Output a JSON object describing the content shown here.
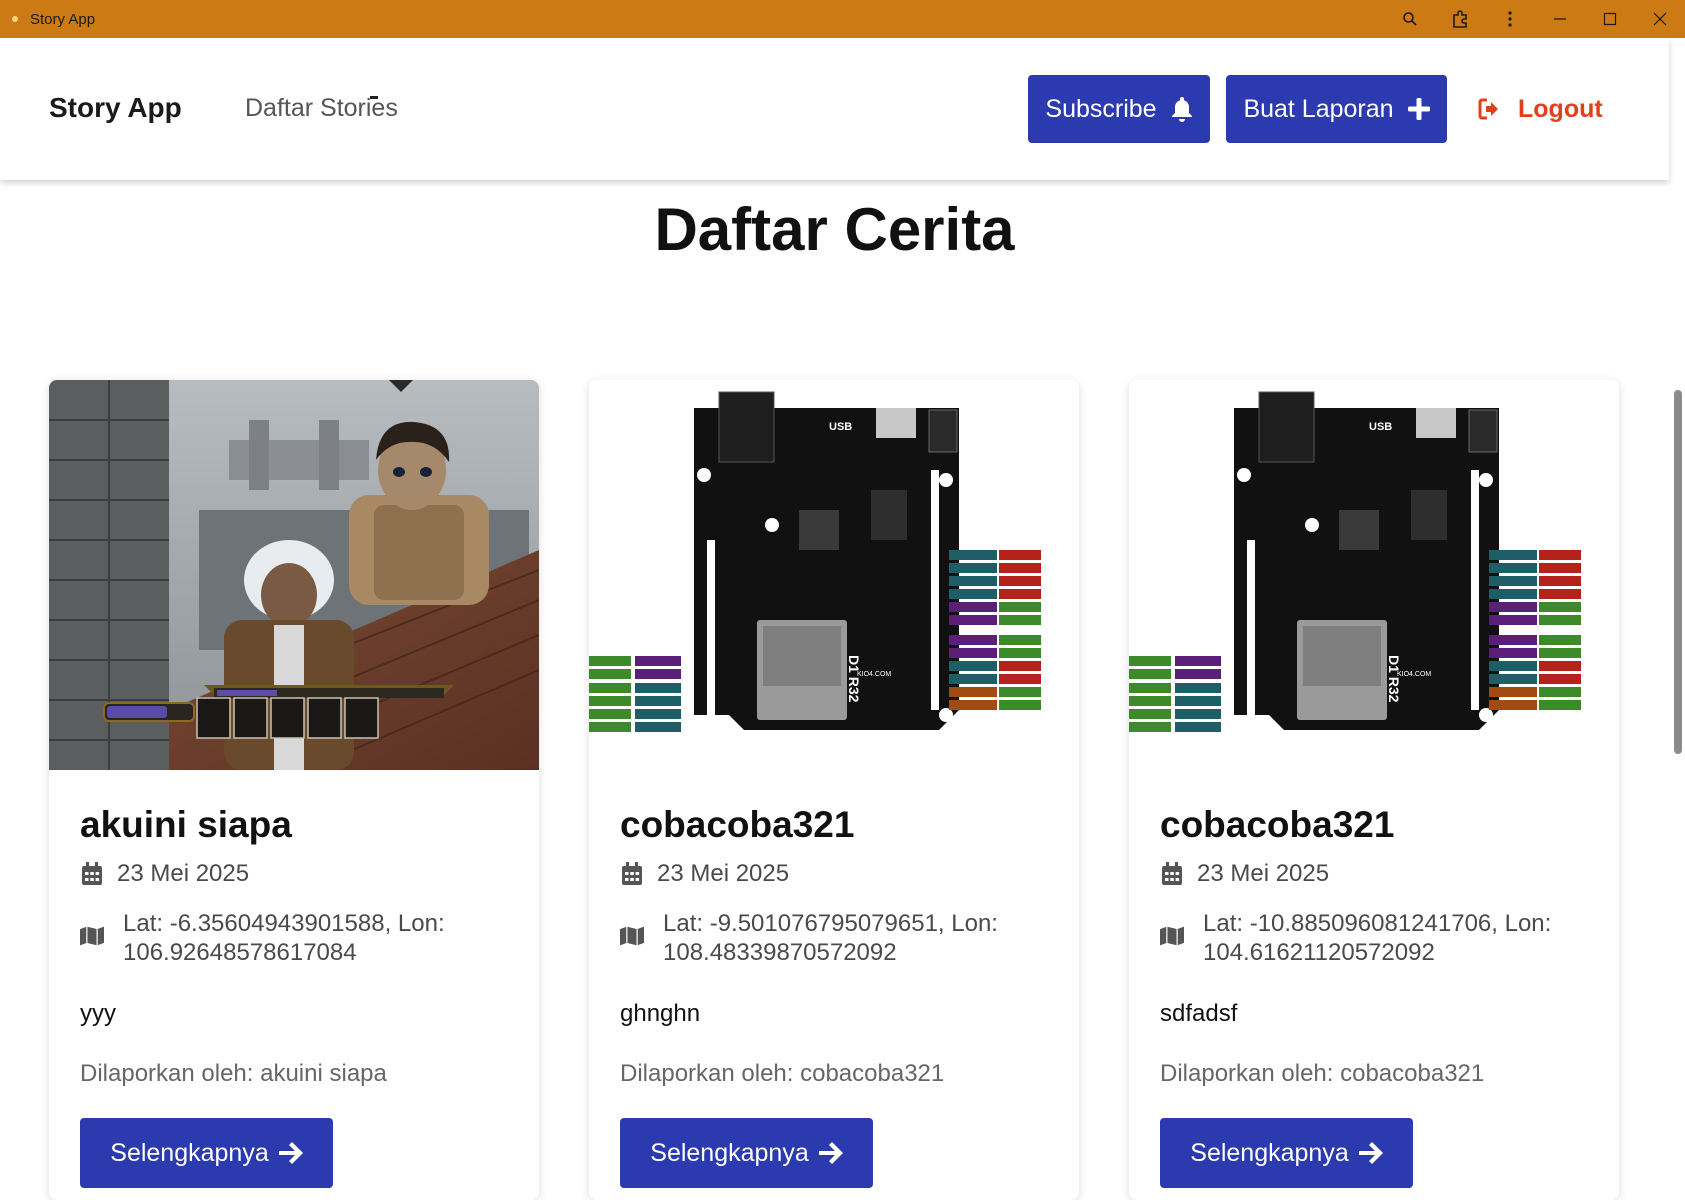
{
  "window": {
    "title": "Story App"
  },
  "navbar": {
    "brand": "Story App",
    "link_stories": "Daftar Stories",
    "subscribe_label": "Subscribe",
    "create_label": "Buat Laporan",
    "logout_label": "Logout"
  },
  "page": {
    "heading": "Daftar Cerita"
  },
  "colors": {
    "titlebar": "#cc7a14",
    "primary": "#2b3aae",
    "logout": "#e0401a"
  },
  "stories": [
    {
      "title": "akuini siapa",
      "date": "23 Mei 2025",
      "location": "Lat: -6.35604943901588, Lon: 106.92648578617084",
      "description": "yyy",
      "reporter": "Dilaporkan oleh: akuini siapa",
      "more_label": "Selengkapnya",
      "image": "game-screenshot"
    },
    {
      "title": "cobacoba321",
      "date": "23 Mei 2025",
      "location": "Lat: -9.501076795079651, Lon: 108.48339870572092",
      "description": "ghnghn",
      "reporter": "Dilaporkan oleh: cobacoba321",
      "more_label": "Selengkapnya",
      "image": "esp32-board",
      "board_labels": {
        "usb": "USB",
        "model": "D1 R32",
        "site": "KIO4.COM"
      }
    },
    {
      "title": "cobacoba321",
      "date": "23 Mei 2025",
      "location": "Lat: -10.885096081241706, Lon: 104.61621120572092",
      "description": "sdfadsf",
      "reporter": "Dilaporkan oleh: cobacoba321",
      "more_label": "Selengkapnya",
      "image": "esp32-board",
      "board_labels": {
        "usb": "USB",
        "model": "D1 R32",
        "site": "KIO4.COM"
      }
    }
  ]
}
